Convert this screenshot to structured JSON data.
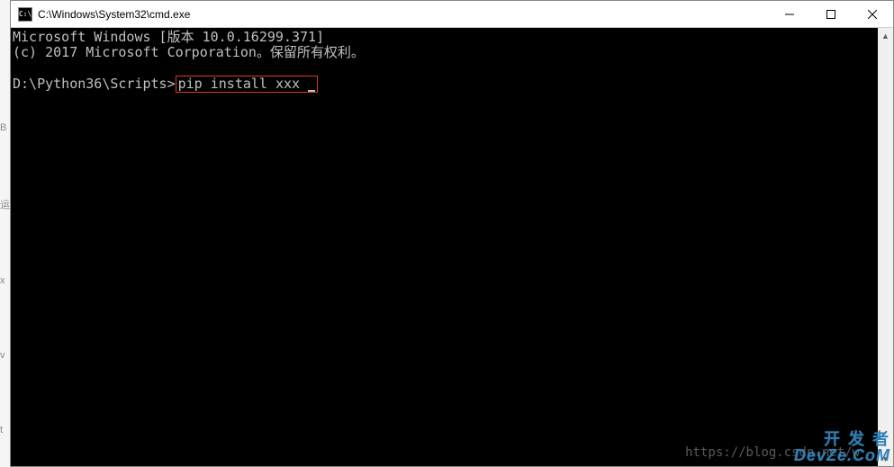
{
  "titlebar": {
    "icon_text": "C:\\",
    "title": "C:\\Windows\\System32\\cmd.exe"
  },
  "terminal": {
    "line1": "Microsoft Windows [版本 10.0.16299.371]",
    "line2": "(c) 2017 Microsoft Corporation。保留所有权利。",
    "prompt": "D:\\Python36\\Scripts>",
    "command": "pip install xxx"
  },
  "watermark": {
    "url": "https://blog.csdn.net/w",
    "logo_top": "开 发 者",
    "logo_bottom": "DevZe.CoM"
  },
  "sidebar_chars": [
    "B",
    "运",
    "x",
    "v",
    "t"
  ]
}
